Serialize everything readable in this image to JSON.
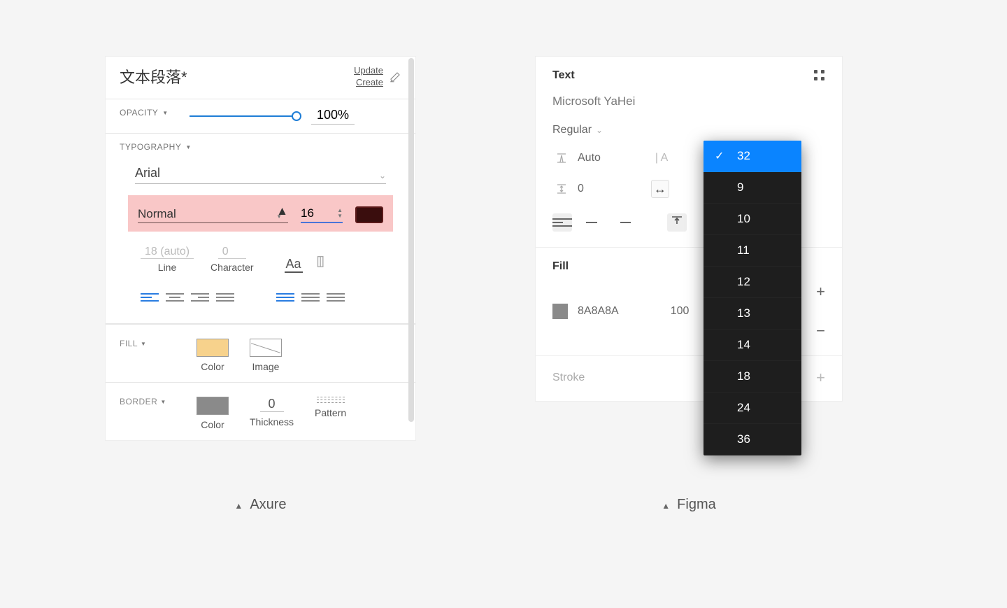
{
  "axure": {
    "title": "文本段落*",
    "update": "Update",
    "create": "Create",
    "opacity_label": "OPACITY",
    "opacity_value": "100%",
    "typography_label": "TYPOGRAPHY",
    "font": "Arial",
    "weight": "Normal",
    "size": "16",
    "line_ph": "18 (auto)",
    "line_label": "Line",
    "char_ph": "0",
    "char_label": "Character",
    "case_label": "Aa",
    "fill_label": "FILL",
    "fill_color_label": "Color",
    "fill_image_label": "Image",
    "border_label": "BORDER",
    "border_color_label": "Color",
    "border_thickness": "0",
    "border_thickness_label": "Thickness",
    "border_pattern_label": "Pattern"
  },
  "figma": {
    "text_label": "Text",
    "font": "Microsoft YaHei",
    "weight": "Regular",
    "auto_label": "Auto",
    "line_letter_pipe": "| A",
    "v_spacing": "0",
    "resize_icon": "↔",
    "fill_label": "Fill",
    "fill_hex": "8A8A8A",
    "fill_opacity": "100",
    "stroke_label": "Stroke",
    "dropdown_selected": "32",
    "dropdown_items": [
      "9",
      "10",
      "11",
      "12",
      "13",
      "14",
      "18",
      "24",
      "36"
    ]
  },
  "captions": {
    "axure": "Axure",
    "figma": "Figma"
  }
}
